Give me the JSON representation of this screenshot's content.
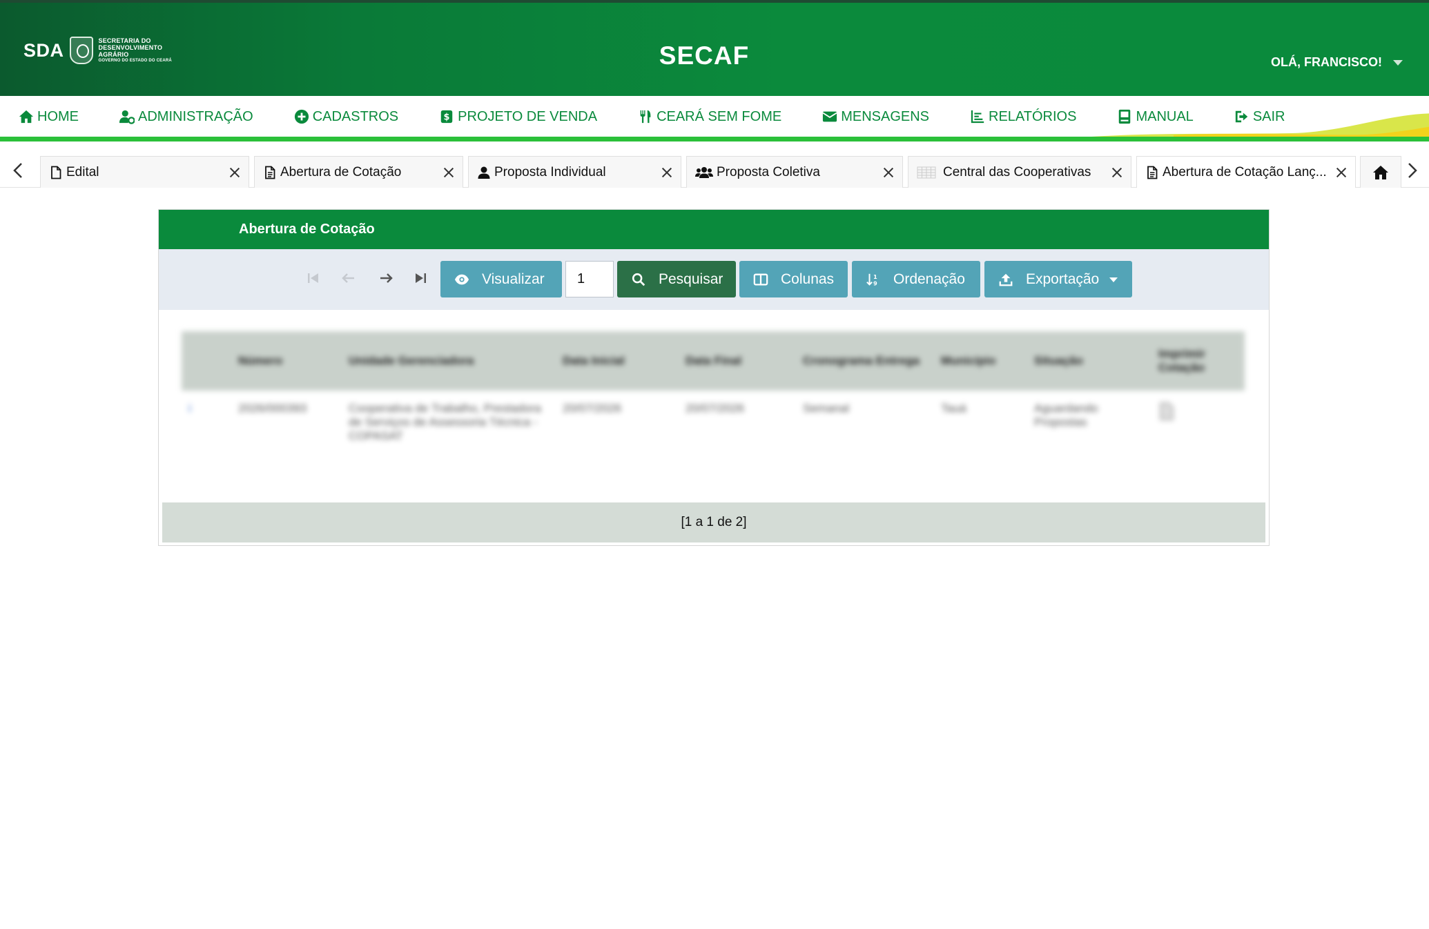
{
  "header": {
    "logo_abbr": "SDA",
    "logo_line1": "SECRETARIA DO",
    "logo_line2": "DESENVOLVIMENTO",
    "logo_line3": "AGRÁRIO",
    "logo_line4": "GOVERNO DO ESTADO DO CEARÁ",
    "app_title": "SECAF",
    "user_greeting": "OLÁ, FRANCISCO!"
  },
  "nav": {
    "items": [
      {
        "label": "HOME",
        "icon": "home-icon"
      },
      {
        "label": "ADMINISTRAÇÃO",
        "icon": "user-gear-icon"
      },
      {
        "label": "CADASTROS",
        "icon": "plus-circle-icon"
      },
      {
        "label": "PROJETO DE VENDA",
        "icon": "money-icon"
      },
      {
        "label": "CEARÁ SEM FOME",
        "icon": "utensils-icon"
      },
      {
        "label": "MENSAGENS",
        "icon": "envelope-icon"
      },
      {
        "label": "RELATÓRIOS",
        "icon": "chart-icon"
      },
      {
        "label": "MANUAL",
        "icon": "book-icon"
      },
      {
        "label": "SAIR",
        "icon": "sign-out-icon"
      }
    ]
  },
  "tabs": {
    "items": [
      {
        "label": "Edital",
        "icon": "file-icon"
      },
      {
        "label": "Abertura de Cotação",
        "icon": "file-text-icon"
      },
      {
        "label": "Proposta Individual",
        "icon": "user-icon"
      },
      {
        "label": "Proposta Coletiva",
        "icon": "users-icon"
      },
      {
        "label": "Central das Cooperativas",
        "icon": "table-icon"
      },
      {
        "label": "Abertura de Cotação Lanç...",
        "icon": "file-text-icon"
      }
    ]
  },
  "panel": {
    "title": "Abertura de Cotação",
    "toolbar": {
      "visualizar": "Visualizar",
      "page_value": "1",
      "pesquisar": "Pesquisar",
      "colunas": "Colunas",
      "ordenacao": "Ordenação",
      "exportacao": "Exportação"
    },
    "table": {
      "headers": [
        "",
        "Número",
        "Unidade Gerenciadora",
        "Data Inicial",
        "Data Final",
        "Cronograma Entrega",
        "Município",
        "Situação",
        "Imprimir Cotação"
      ],
      "rows": [
        [
          "i",
          "2026/000393",
          "Cooperativa de Trabalho, Prestadora de Serviços de Assessoria Técnica - COPASAT",
          "20/07/2026",
          "20/07/2026",
          "Semanal",
          "Tauá",
          "Aguardando Propostas",
          ""
        ]
      ]
    },
    "pagination_text": "[1 a 1 de 2]"
  },
  "colors": {
    "brand_green": "#0a8a3c",
    "nav_accent": "#2bc039",
    "button_teal": "#53a4b7",
    "button_dark": "#2b7047"
  }
}
